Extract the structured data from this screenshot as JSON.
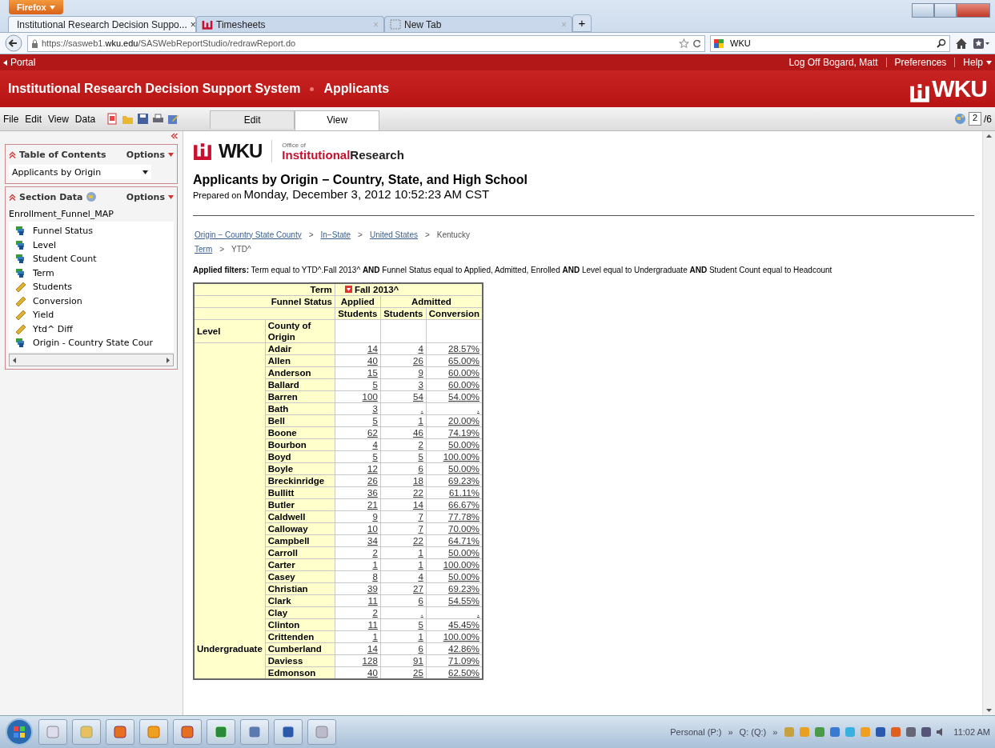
{
  "browser": {
    "menu_button": "Firefox",
    "tabs": [
      {
        "title": "Institutional Research Decision Suppo...",
        "close": "×",
        "selected": true
      },
      {
        "title": "Timesheets",
        "close": "×",
        "selected": false
      },
      {
        "title": "New Tab",
        "close": "×",
        "selected": false
      }
    ],
    "new_tab": "+",
    "url": "https://sasweb1.**wku.edu**/SASWebReportStudio/redrawReport.do",
    "search": "WKU"
  },
  "app": {
    "portal": "Portal",
    "user_links": [
      "Log Off Bogard, Matt",
      "Preferences",
      "Help"
    ],
    "title": "Institutional Research Decision Support System",
    "section": "Applicants",
    "logo": "WKU"
  },
  "menubar": {
    "menus": [
      "File",
      "Edit",
      "View",
      "Data"
    ],
    "view_tabs": [
      {
        "label": "Edit",
        "selected": false
      },
      {
        "label": "View",
        "selected": true
      }
    ],
    "page": "2",
    "page_total": "/6"
  },
  "sidebar": {
    "toc": {
      "title": "Table of Contents",
      "options": "Options",
      "report": "Applicants by Origin"
    },
    "section_data": {
      "title": "Section Data",
      "options": "Options",
      "source": "Enrollment_Funnel_MAP",
      "items": [
        {
          "label": "Funnel Status",
          "kind": "category"
        },
        {
          "label": "Level",
          "kind": "category"
        },
        {
          "label": "Student Count",
          "kind": "category"
        },
        {
          "label": "Term",
          "kind": "category"
        },
        {
          "label": "Students",
          "kind": "measure"
        },
        {
          "label": "Conversion",
          "kind": "measure"
        },
        {
          "label": "Yield",
          "kind": "measure"
        },
        {
          "label": "Ytd^ Diff",
          "kind": "measure"
        },
        {
          "label": "Origin - Country State Cour",
          "kind": "category"
        }
      ]
    }
  },
  "report": {
    "logo": "WKU",
    "office_of": "Office of",
    "department": "Institutional",
    "department_2": "Research",
    "title": "Applicants by Origin − Country, State, and High School",
    "prepared_label": "Prepared on",
    "prepared_value": "Monday, December 3, 2012 10:52:23 AM CST",
    "breadcrumbs": [
      [
        {
          "label": "Origin − Country State County",
          "link": true
        },
        {
          "label": ">",
          "link": false
        },
        {
          "label": "In−State",
          "link": true
        },
        {
          "label": ">",
          "link": false
        },
        {
          "label": "United States",
          "link": true
        },
        {
          "label": ">",
          "link": false
        },
        {
          "label": "Kentucky",
          "link": false
        }
      ],
      [
        {
          "label": "Term",
          "link": true
        },
        {
          "label": ">",
          "link": false
        },
        {
          "label": "YTD^",
          "link": false
        }
      ]
    ],
    "filters": "**Applied filters:** Term equal to YTD^.Fall 2013^ **AND** Funnel Status equal to Applied, Admitted, Enrolled **AND** Level equal to Undergraduate **AND** Student Count equal to Headcount",
    "table": {
      "term_label": "Term",
      "term_value": "Fall 2013^",
      "funnel_label": "Funnel Status",
      "statuses": [
        "Applied",
        "Admitted"
      ],
      "measures": [
        "Students",
        "Students",
        "Conversion"
      ],
      "level_label": "Level",
      "county_label": "County of Origin",
      "level_value": "Undergraduate",
      "rows": [
        {
          "county": "Adair",
          "applied": "14",
          "admitted": "4",
          "conversion": "28.57%"
        },
        {
          "county": "Allen",
          "applied": "40",
          "admitted": "26",
          "conversion": "65.00%"
        },
        {
          "county": "Anderson",
          "applied": "15",
          "admitted": "9",
          "conversion": "60.00%"
        },
        {
          "county": "Ballard",
          "applied": "5",
          "admitted": "3",
          "conversion": "60.00%"
        },
        {
          "county": "Barren",
          "applied": "100",
          "admitted": "54",
          "conversion": "54.00%"
        },
        {
          "county": "Bath",
          "applied": "3",
          "admitted": ".",
          "conversion": "."
        },
        {
          "county": "Bell",
          "applied": "5",
          "admitted": "1",
          "conversion": "20.00%"
        },
        {
          "county": "Boone",
          "applied": "62",
          "admitted": "46",
          "conversion": "74.19%"
        },
        {
          "county": "Bourbon",
          "applied": "4",
          "admitted": "2",
          "conversion": "50.00%"
        },
        {
          "county": "Boyd",
          "applied": "5",
          "admitted": "5",
          "conversion": "100.00%"
        },
        {
          "county": "Boyle",
          "applied": "12",
          "admitted": "6",
          "conversion": "50.00%"
        },
        {
          "county": "Breckinridge",
          "applied": "26",
          "admitted": "18",
          "conversion": "69.23%"
        },
        {
          "county": "Bullitt",
          "applied": "36",
          "admitted": "22",
          "conversion": "61.11%"
        },
        {
          "county": "Butler",
          "applied": "21",
          "admitted": "14",
          "conversion": "66.67%"
        },
        {
          "county": "Caldwell",
          "applied": "9",
          "admitted": "7",
          "conversion": "77.78%"
        },
        {
          "county": "Calloway",
          "applied": "10",
          "admitted": "7",
          "conversion": "70.00%"
        },
        {
          "county": "Campbell",
          "applied": "34",
          "admitted": "22",
          "conversion": "64.71%"
        },
        {
          "county": "Carroll",
          "applied": "2",
          "admitted": "1",
          "conversion": "50.00%"
        },
        {
          "county": "Carter",
          "applied": "1",
          "admitted": "1",
          "conversion": "100.00%"
        },
        {
          "county": "Casey",
          "applied": "8",
          "admitted": "4",
          "conversion": "50.00%"
        },
        {
          "county": "Christian",
          "applied": "39",
          "admitted": "27",
          "conversion": "69.23%"
        },
        {
          "county": "Clark",
          "applied": "11",
          "admitted": "6",
          "conversion": "54.55%"
        },
        {
          "county": "Clay",
          "applied": "2",
          "admitted": ".",
          "conversion": "."
        },
        {
          "county": "Clinton",
          "applied": "11",
          "admitted": "5",
          "conversion": "45.45%"
        },
        {
          "county": "Crittenden",
          "applied": "1",
          "admitted": "1",
          "conversion": "100.00%"
        },
        {
          "county": "Cumberland",
          "applied": "14",
          "admitted": "6",
          "conversion": "42.86%"
        },
        {
          "county": "Daviess",
          "applied": "128",
          "admitted": "91",
          "conversion": "71.09%"
        },
        {
          "county": "Edmonson",
          "applied": "40",
          "admitted": "25",
          "conversion": "62.50%"
        }
      ]
    }
  },
  "taskbar": {
    "tray_items": [
      "Personal (P:)",
      "»",
      "Q: (Q:)",
      "»"
    ],
    "clock": "11:02 AM"
  }
}
